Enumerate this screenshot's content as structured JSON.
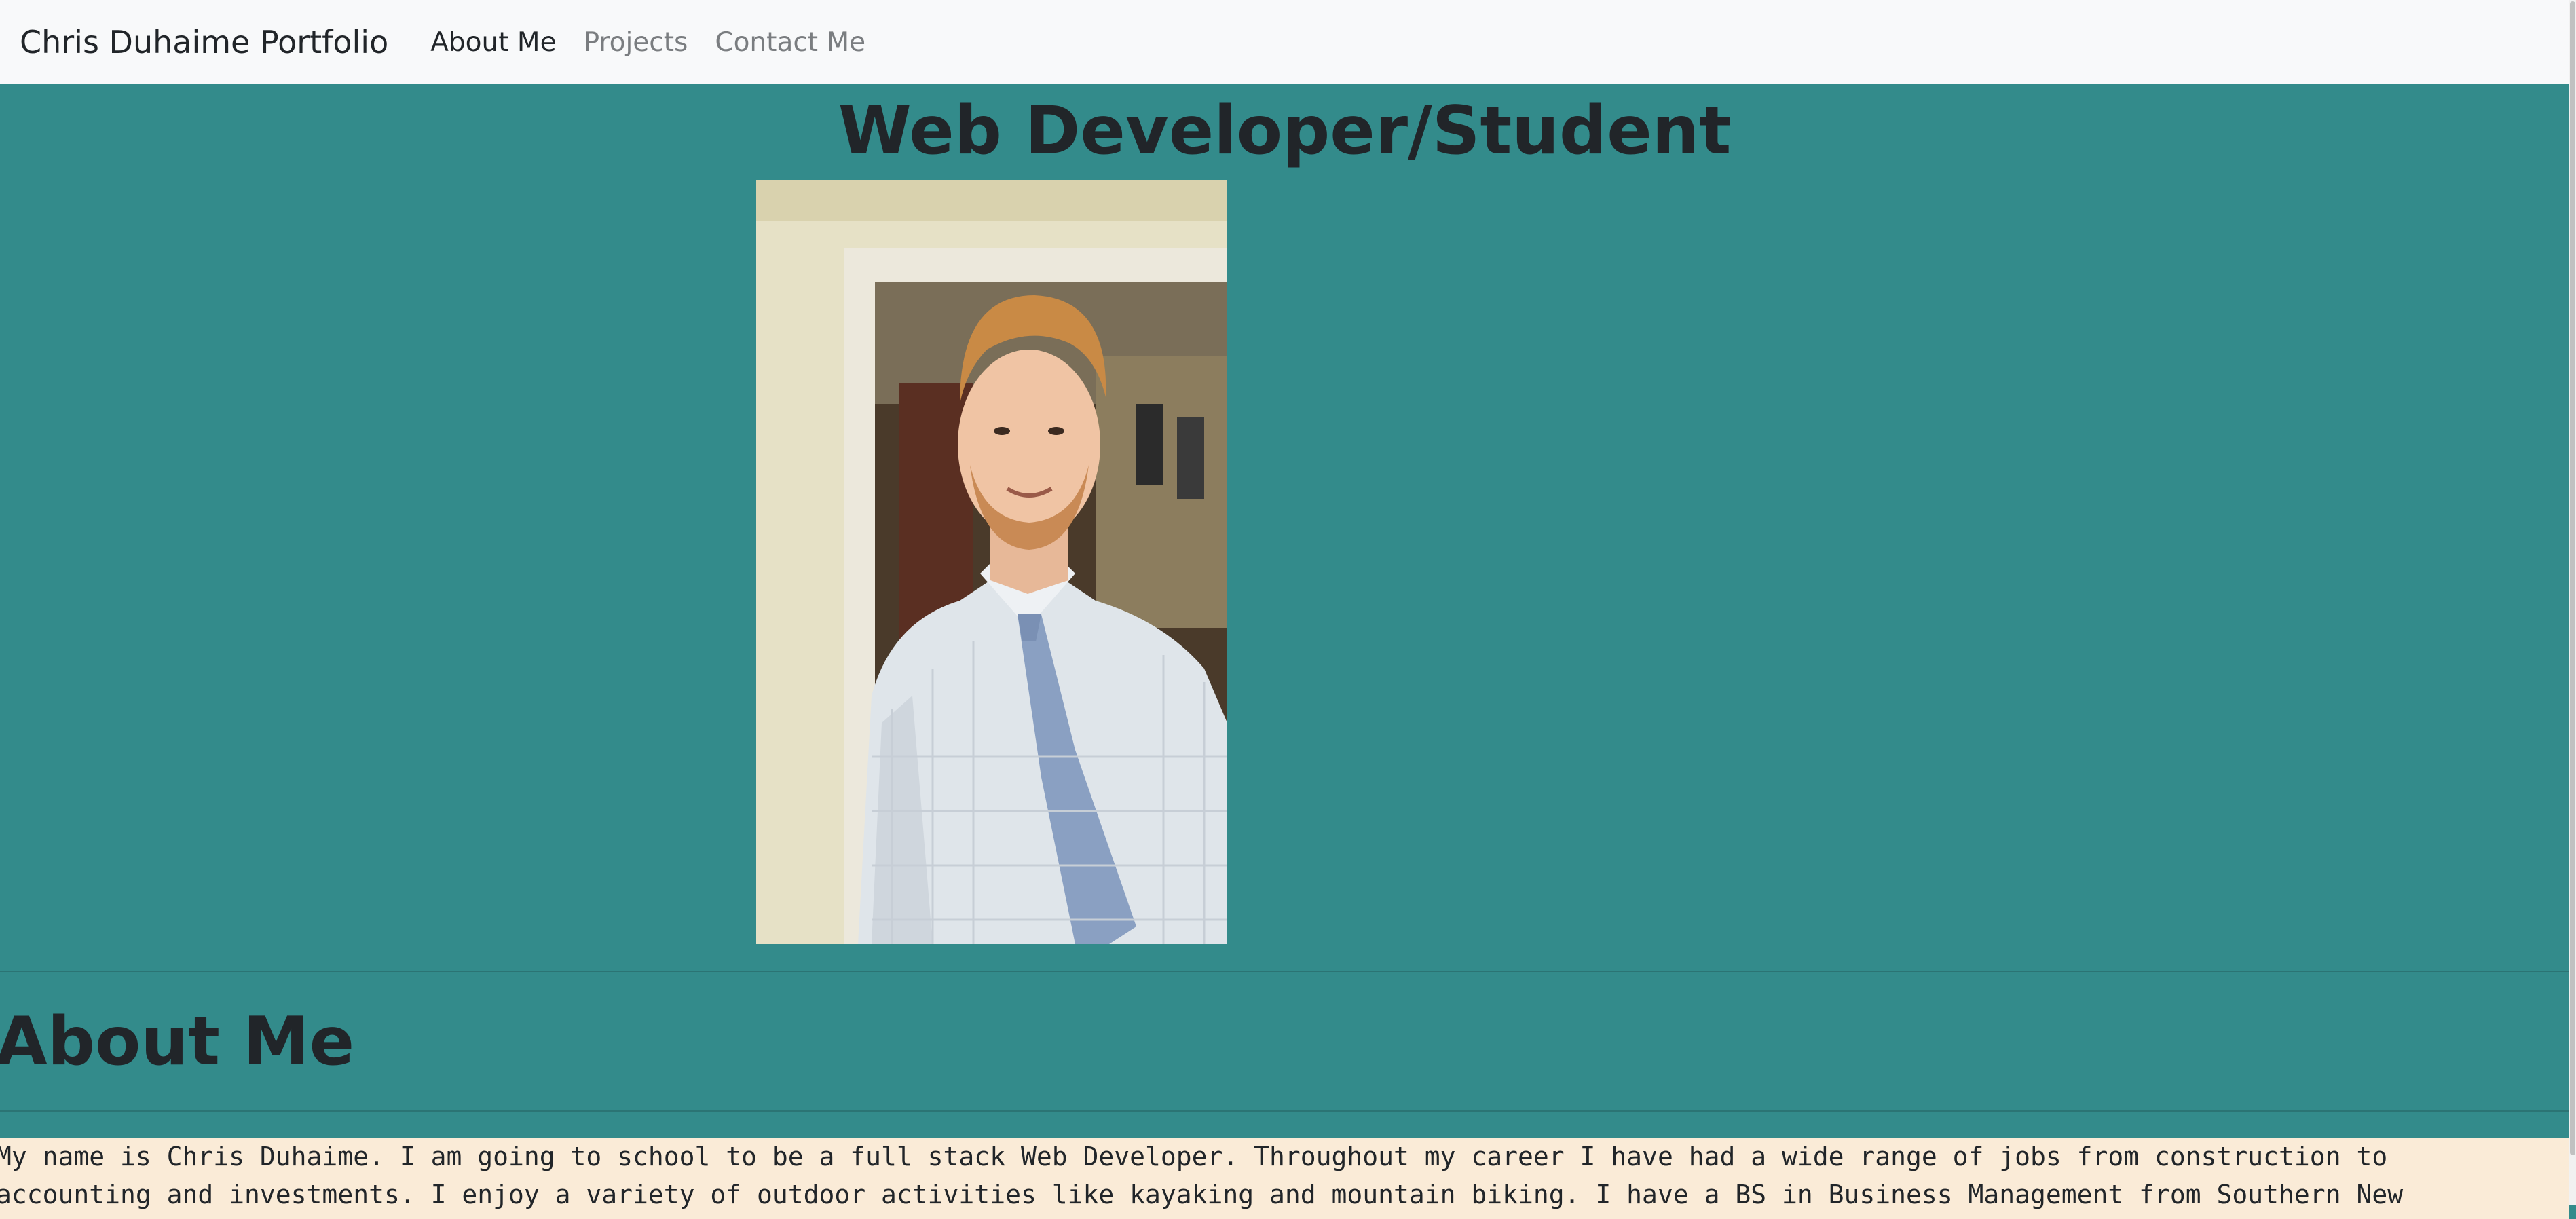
{
  "navbar": {
    "brand": "Chris Duhaime Portfolio",
    "links": [
      {
        "label": "About Me",
        "active": true
      },
      {
        "label": "Projects",
        "active": false
      },
      {
        "label": "Contact Me",
        "active": false
      }
    ]
  },
  "hero": {
    "title": "Web Developer/Student",
    "photo_subject": "portrait-photo"
  },
  "about": {
    "heading": "About Me",
    "text": "My name is Chris Duhaime. I am going to school to be a full stack Web Developer. Throughout my career I have had a wide range of jobs from construction to accounting and investments. I enjoy a variety of outdoor activities like kayaking and mountain biking. I have a BS in Business Management from Southern New Hampshire University."
  },
  "colors": {
    "page_background": "#338b8b",
    "navbar_background": "#f8f9fa",
    "about_text_background": "#faebd7",
    "heading_text": "#212529"
  }
}
